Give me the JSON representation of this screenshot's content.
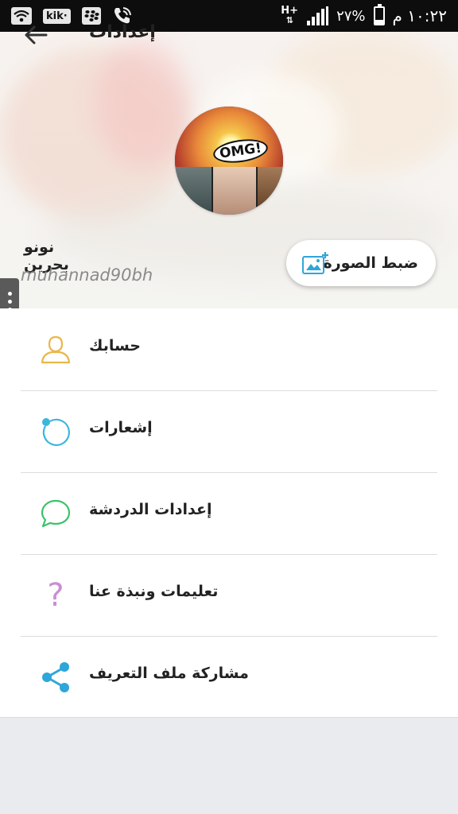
{
  "status_bar": {
    "time": "١٠:٢٢ م",
    "battery": "٢٧%",
    "network_type": "H+",
    "battery_level_fraction": 0.27,
    "icons": [
      "wifi-icon",
      "kik-icon",
      "blackberry-icon",
      "phone-wifi-icon",
      "signal-icon",
      "battery-icon"
    ],
    "kik_label": "kik·"
  },
  "header": {
    "title": "إعدادات",
    "back_icon": "arrow-left-icon"
  },
  "profile": {
    "display_name": "نونو بحرين",
    "username": "muhannad90bh",
    "set_photo_label": "ضبط الصورة",
    "avatar_text": "OMG!"
  },
  "menu": {
    "items": [
      {
        "label": "حسابك",
        "icon": "user-icon",
        "color": "#e8b84a"
      },
      {
        "label": "إشعارات",
        "icon": "notification-ring-icon",
        "color": "#3ab7dd"
      },
      {
        "label": "إعدادات الدردشة",
        "icon": "chat-bubble-icon",
        "color": "#3cc26a"
      },
      {
        "label": "تعليمات ونبذة عنا",
        "icon": "question-icon",
        "color": "#c98ed6"
      },
      {
        "label": "مشاركة ملف التعريف",
        "icon": "share-icon",
        "color": "#2fa6d9"
      }
    ]
  },
  "colors": {
    "accent": "#2fa6d9",
    "background": "#e9ebee"
  }
}
